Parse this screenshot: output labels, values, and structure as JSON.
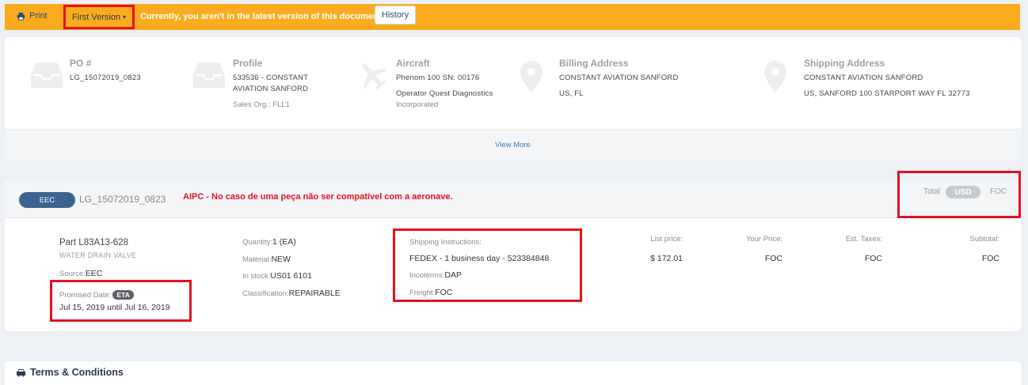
{
  "topbar": {
    "print_label": "Print",
    "version_label": "First Version",
    "notice": "Currently, you aren't in the latest version of this document.",
    "history_label": "History",
    "bg_color": "#fbab1e"
  },
  "info": {
    "po": {
      "title": "PO #",
      "value": "LG_15072019_0823"
    },
    "profile": {
      "title": "Profile",
      "line1": "533536 - CONSTANT",
      "line2": "AVIATION SANFORD",
      "sales_org": "Sales Org.: FLL1"
    },
    "aircraft": {
      "title": "Aircraft",
      "model": "Phenom 100 SN: 00176",
      "operator1": "Operator Quest Diagnostics",
      "operator2": "Incorporated"
    },
    "billing": {
      "title": "Billing Address",
      "line1": "CONSTANT AVIATION SANFORD",
      "line2": "US, FL"
    },
    "shipping": {
      "title": "Shipping Address",
      "line1": "CONSTANT AVIATION SANFORD",
      "line2": "US, SANFORD 100 STARPORT WAY FL 32773"
    },
    "view_more": "View More"
  },
  "order": {
    "badge": "EEC",
    "id": "LG_15072019_0823",
    "note": "AIPC - No caso de uma peça não ser compatível com a aeronave.",
    "total_label": "Total",
    "currency": "USD",
    "total_value": "FOC"
  },
  "item": {
    "part_label": "Part",
    "part_number": "L83A13-628",
    "description": "WATER DRAIN VALVE",
    "source_label": "Source:",
    "source": "EEC",
    "promised_label": "Promised Date:",
    "eta_badge": "ETA",
    "promised_dates": "Jul 15, 2019 until Jul 16, 2019",
    "quantity_label": "Quantity:",
    "quantity": "1 (EA)",
    "material_label": "Material:",
    "material": "NEW",
    "stock_label": "In stock:",
    "stock": "US01 6101",
    "class_label": "Classification:",
    "classification": "REPAIRABLE",
    "ship_instr_label": "Shipping Instructions:",
    "ship_instr": "FEDEX - 1 business day - 523384848",
    "incoterms_label": "Incoterms:",
    "incoterms": "DAP",
    "freight_label": "Freight:",
    "freight": "FOC",
    "list_price_label": "List price:",
    "list_price": "$ 172.01",
    "your_price_label": "Your Price:",
    "your_price": "FOC",
    "taxes_label": "Est. Taxes:",
    "taxes": "FOC",
    "subtotal_label": "Subtotal:",
    "subtotal": "FOC"
  },
  "terms": {
    "title": "Terms & Conditions"
  },
  "icons": [
    "print-icon",
    "inbox-icon",
    "airplane-icon",
    "map-pin-icon",
    "car-icon"
  ]
}
